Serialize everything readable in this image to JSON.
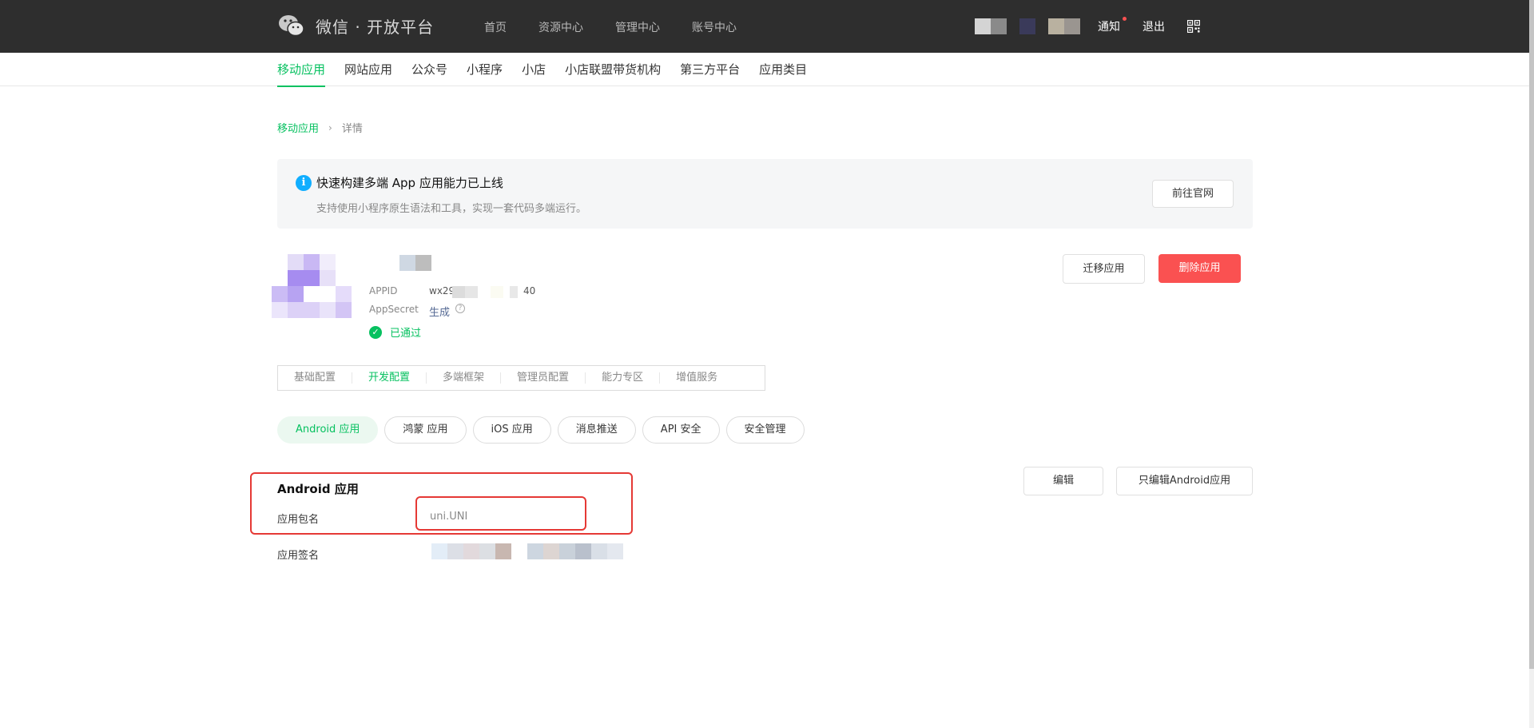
{
  "topbar": {
    "brand_title": "微信 · 开放平台",
    "nav": [
      "首页",
      "资源中心",
      "管理中心",
      "账号中心"
    ],
    "notify_label": "通知",
    "logout_label": "退出",
    "mosaic_colors": [
      "#d4d4d4",
      "#8a8a8a",
      "#2e2e2e",
      "#3a3a5a",
      "#2e2e2e",
      "#b9b1a0",
      "#9a9590"
    ]
  },
  "category_nav": {
    "items": [
      "移动应用",
      "网站应用",
      "公众号",
      "小程序",
      "小店",
      "小店联盟带货机构",
      "第三方平台",
      "应用类目"
    ],
    "active_index": 0
  },
  "breadcrumb": {
    "parent": "移动应用",
    "separator": "›",
    "current": "详情"
  },
  "banner": {
    "icon": "info-icon",
    "title": "快速构建多端 App 应用能力已上线",
    "subtitle": "支持使用小程序原生语法和工具，实现一套代码多端运行。",
    "button": "前往官网"
  },
  "app": {
    "appid_label": "APPID",
    "appid_prefix": "wx29",
    "appid_suffix": "40",
    "appsecret_label": "AppSecret",
    "appsecret_action": "生成",
    "status": "已通过",
    "migrate_button": "迁移应用",
    "delete_button": "删除应用"
  },
  "tabs": {
    "items": [
      "基础配置",
      "开发配置",
      "多端框架",
      "管理员配置",
      "能力专区",
      "增值服务"
    ],
    "active_index": 1
  },
  "platform_pills": {
    "items": [
      "Android 应用",
      "鸿蒙 应用",
      "iOS 应用",
      "消息推送",
      "API 安全",
      "安全管理"
    ],
    "active_index": 0
  },
  "android_section": {
    "title": "Android 应用",
    "package_label": "应用包名",
    "package_value": "uni.UNI",
    "signature_label": "应用签名",
    "edit_button": "编辑",
    "edit_android_button": "只编辑Android应用"
  },
  "colors": {
    "brand_green": "#07c160",
    "danger_red": "#fa5151",
    "highlight_red": "#e53935",
    "topbar_bg": "#2e2e2e"
  }
}
